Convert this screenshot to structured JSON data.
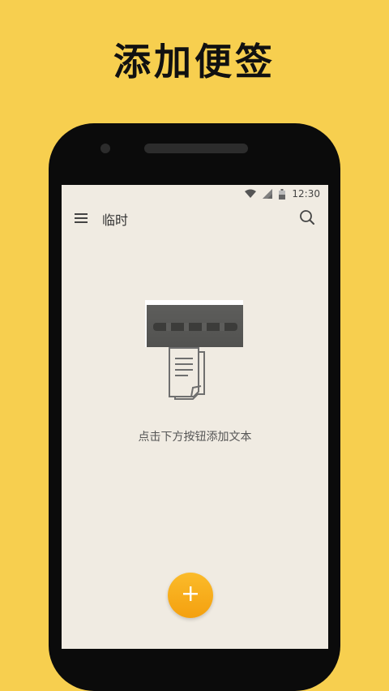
{
  "promo": {
    "headline": "添加便签"
  },
  "status_bar": {
    "time": "12:30",
    "icons": [
      "wifi-icon",
      "signal-icon",
      "battery-icon"
    ]
  },
  "toolbar": {
    "title": "临时",
    "menu_icon": "menu-icon",
    "search_icon": "search-icon"
  },
  "empty_state": {
    "message": "点击下方按钮添加文本",
    "icon": "document-icon"
  },
  "fab": {
    "icon": "plus-icon"
  },
  "colors": {
    "background": "#f7cf4f",
    "screen": "#f0ebe2",
    "accent": "#f4a00f"
  }
}
